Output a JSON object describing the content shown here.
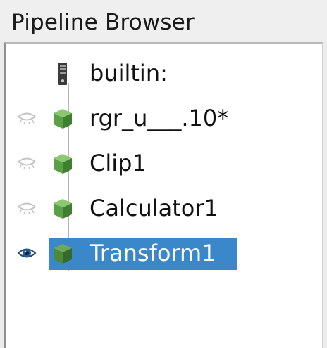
{
  "panel": {
    "title": "Pipeline Browser"
  },
  "tree": {
    "items": [
      {
        "label": "builtin:",
        "icon": "server-icon",
        "eye": "none",
        "selected": false
      },
      {
        "label": "rgr_u___.10*",
        "icon": "dataset-cube-icon",
        "eye": "hidden",
        "selected": false
      },
      {
        "label": "Clip1",
        "icon": "dataset-cube-icon",
        "eye": "hidden",
        "selected": false
      },
      {
        "label": "Calculator1",
        "icon": "dataset-cube-icon",
        "eye": "hidden",
        "selected": false
      },
      {
        "label": "Transform1",
        "icon": "dataset-cube-icon",
        "eye": "visible",
        "selected": true
      }
    ]
  },
  "colors": {
    "selection": "#3a87c9",
    "cube_green": "#5aa046"
  }
}
